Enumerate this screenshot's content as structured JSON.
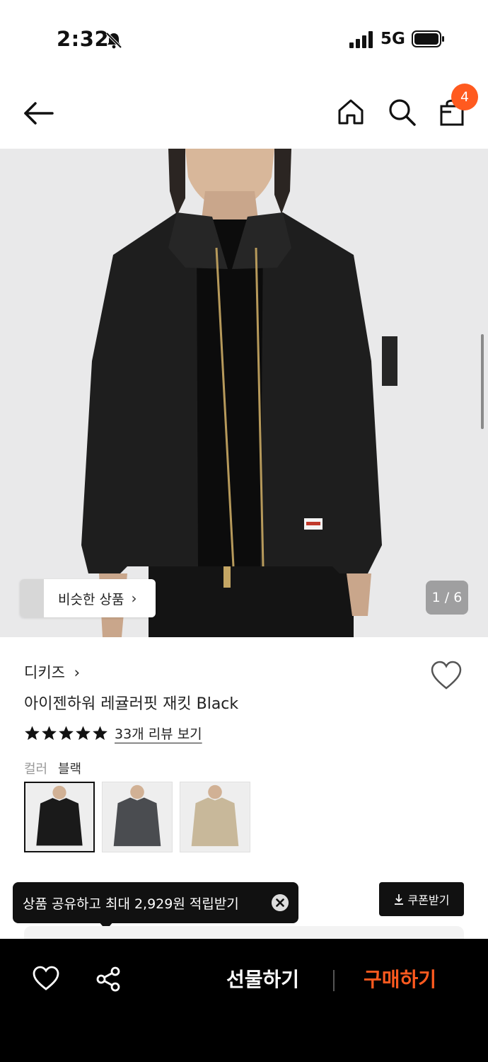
{
  "status_bar": {
    "time": "2:32",
    "network": "5G",
    "icons": [
      "bell-slash-icon",
      "signal-icon",
      "battery-icon"
    ]
  },
  "nav": {
    "cart_count": "4",
    "icons": [
      "back-arrow-icon",
      "home-icon",
      "search-icon",
      "shopping-bag-icon"
    ]
  },
  "hero": {
    "similar_label": "비슷한 상품",
    "page_counter": "1 / 6"
  },
  "product": {
    "brand": "디키즈",
    "title": "아이젠하워 레귤러핏 재킷 Black",
    "rating": 5,
    "reviews_link": "33개 리뷰 보기",
    "color_label": "컬러",
    "color_value": "블랙",
    "swatches": [
      "black",
      "charcoal",
      "khaki"
    ]
  },
  "promo": {
    "share_tip": "상품 공유하고 최대 2,929원 적립받기",
    "coupon_label": "쿠폰받기"
  },
  "bottom_bar": {
    "gift_label": "선물하기",
    "buy_label": "구매하기"
  },
  "colors": {
    "accent": "#ff5a1f",
    "bottom_bar_bg": "#000000",
    "hero_bg": "#e9e9ea"
  }
}
